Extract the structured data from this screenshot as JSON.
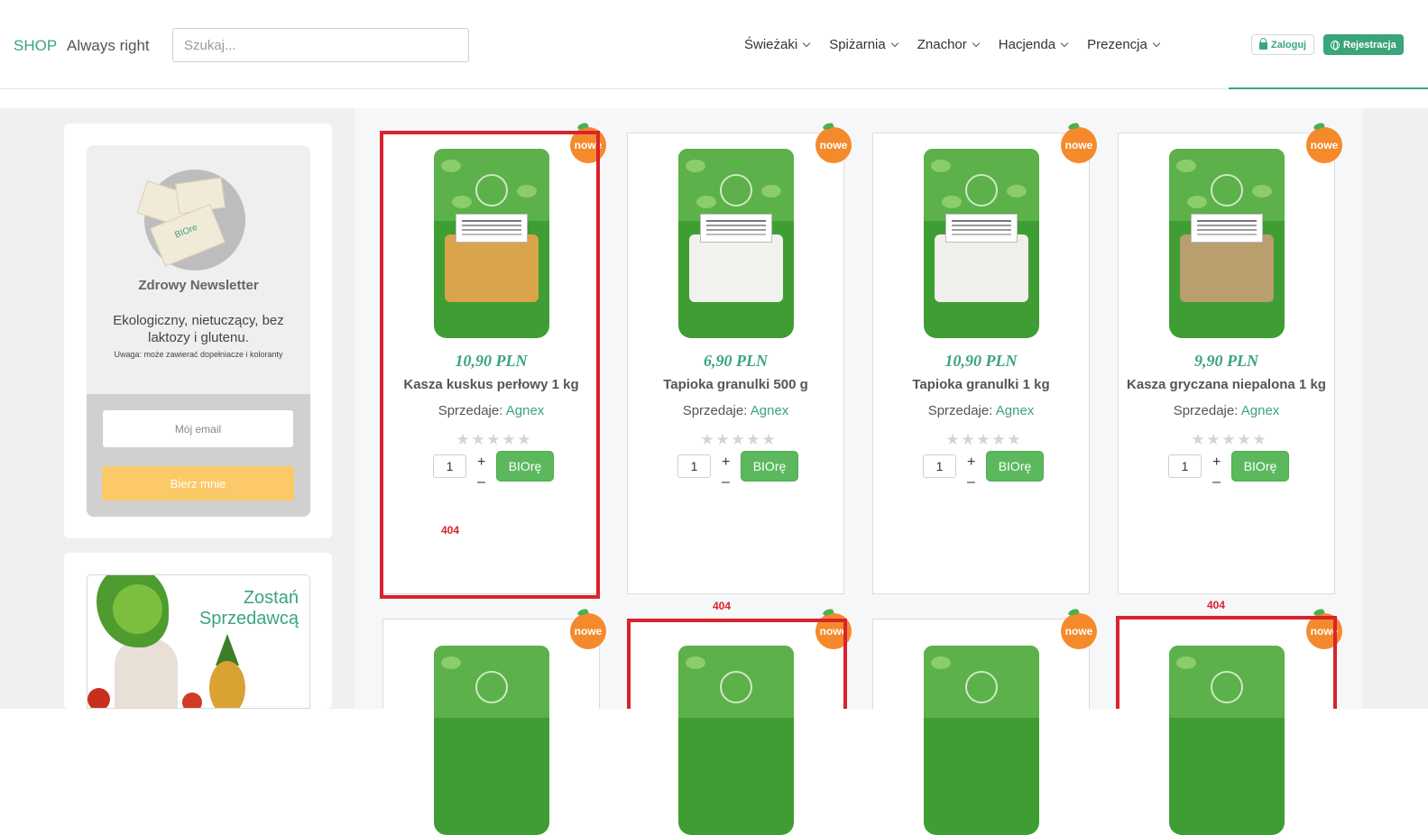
{
  "header": {
    "brand": "SHOP",
    "slogan": "Always right",
    "search_placeholder": "Szukaj...",
    "nav": [
      "Świeżaki",
      "Spiżarnia",
      "Znachor",
      "Hacjenda",
      "Prezencja"
    ],
    "login_label": "Zaloguj",
    "register_label": "Rejestracja",
    "accent_color": "#3aa57a"
  },
  "sidebar": {
    "newsletter": {
      "title": "Zdrowy Newsletter",
      "description": "Ekologiczny, nietuczący, bez laktozy i glutenu.",
      "note": "Uwaga: może zawierać dopełniacze i koloranty",
      "email_placeholder": "Mój email",
      "button_label": "Bierz mnie",
      "envelope_text": "BIOre"
    },
    "seller_banner": {
      "title": "Zostań Sprzedawcą"
    }
  },
  "products": [
    {
      "price": "10,90 PLN",
      "name": "Kasza kuskus perłowy 1 kg",
      "seller_label": "Sprzedaje:",
      "vendor": "Agnex",
      "qty": "1",
      "buy_label": "BIOrę",
      "badge": "nowe",
      "fill": "#d9a44a"
    },
    {
      "price": "6,90 PLN",
      "name": "Tapioka granulki 500 g",
      "seller_label": "Sprzedaje:",
      "vendor": "Agnex",
      "qty": "1",
      "buy_label": "BIOrę",
      "badge": "nowe",
      "fill": "#f1f1ed"
    },
    {
      "price": "10,90 PLN",
      "name": "Tapioka granulki 1 kg",
      "seller_label": "Sprzedaje:",
      "vendor": "Agnex",
      "qty": "1",
      "buy_label": "BIOrę",
      "badge": "nowe",
      "fill": "#efefeb"
    },
    {
      "price": "9,90 PLN",
      "name": "Kasza gryczana niepalona 1 kg",
      "seller_label": "Sprzedaje:",
      "vendor": "Agnex",
      "qty": "1",
      "buy_label": "BIOrę",
      "badge": "nowe",
      "fill": "#b99e6e"
    }
  ],
  "second_row_badges": [
    "nowe",
    "nowe",
    "nowe",
    "nowe"
  ],
  "errors": [
    "404",
    "404",
    "404"
  ],
  "rating_stars": 5
}
